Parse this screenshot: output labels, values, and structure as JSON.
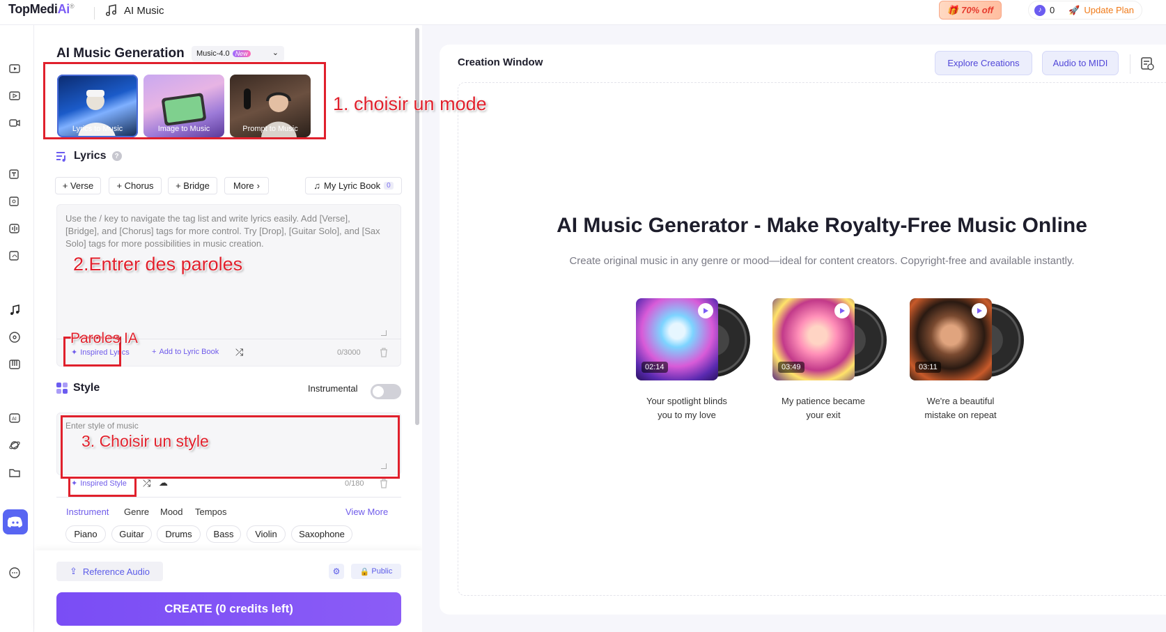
{
  "header": {
    "logo_text": "TopMedi",
    "logo_ai": "Ai",
    "logo_reg": "®",
    "app_name": "AI Music",
    "promo_text": "70% off",
    "credits": "0",
    "update_plan": "Update Plan"
  },
  "left": {
    "title": "AI Music Generation",
    "model": "Music-4.0",
    "model_badge": "New",
    "modes": [
      {
        "label": "Lyrics to Music"
      },
      {
        "label": "Image to Music"
      },
      {
        "label": "Prompt to Music"
      }
    ],
    "lyrics": {
      "title": "Lyrics",
      "help": "?",
      "tags": [
        "+ Verse",
        "+ Chorus",
        "+ Bridge"
      ],
      "more": "More",
      "lyric_book": "My Lyric Book",
      "lyric_book_count": "0",
      "placeholder": "Use the / key to navigate the tag list and write lyrics easily. Add [Verse], [Bridge], and [Chorus] tags for more control. Try [Drop], [Guitar Solo], and [Sax Solo] tags for more possibilities in music creation.",
      "inspired": "Inspired Lyrics",
      "add_book": "Add to Lyric Book",
      "counter": "0/3000"
    },
    "style": {
      "title": "Style",
      "instrumental": "Instrumental",
      "placeholder": "Enter style of music",
      "inspired": "Inspired Style",
      "counter": "0/180",
      "categories": [
        "Instrument",
        "Genre",
        "Mood",
        "Tempos"
      ],
      "view_more": "View More",
      "chips": [
        "Piano",
        "Guitar",
        "Drums",
        "Bass",
        "Violin",
        "Saxophone"
      ]
    },
    "reference_audio": "Reference Audio",
    "public": "Public",
    "create": "CREATE (0 credits left)"
  },
  "annotations": {
    "a1": "1. choisir un mode",
    "a2": "2.Entrer des paroles",
    "a3": "Paroles IA",
    "a4": "3. Choisir un style"
  },
  "right": {
    "title": "Creation Window",
    "explore": "Explore Creations",
    "audio_midi": "Audio to MIDI",
    "hero": "AI Music Generator - Make Royalty-Free Music Online",
    "sub": "Create original music in any genre or mood—ideal for content creators. Copyright-free and available instantly.",
    "songs": [
      {
        "duration": "02:14",
        "caption_1": "Your spotlight blinds",
        "caption_2": "you to my love"
      },
      {
        "duration": "03:49",
        "caption_1": "My patience became",
        "caption_2": "your exit"
      },
      {
        "duration": "03:11",
        "caption_1": "We're a beautiful",
        "caption_2": "mistake on repeat"
      }
    ]
  },
  "colors": {
    "accent": "#7a4df5",
    "annotation": "#e0202c"
  }
}
